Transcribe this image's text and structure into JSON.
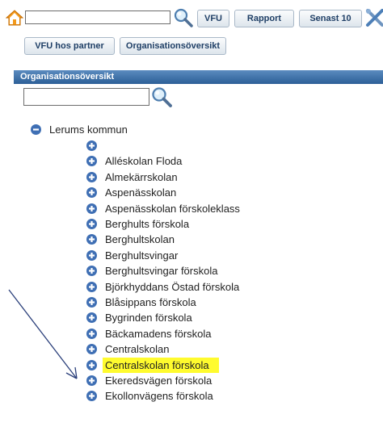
{
  "toolbar": {
    "search_value": "",
    "vfu_label": "VFU",
    "rapport_label": "Rapport",
    "senast_label": "Senast 10",
    "vfu_partner_label": "VFU hos partner",
    "org_overview_label": "Organisationsöversikt"
  },
  "panel": {
    "title": "Organisationsöversikt",
    "search_value": ""
  },
  "tree": {
    "root": {
      "label": "Lerums kommun",
      "icon": "collapse-icon"
    },
    "children": [
      {
        "label": ""
      },
      {
        "label": "Alléskolan Floda"
      },
      {
        "label": "Almekärrskolan"
      },
      {
        "label": "Aspenässkolan"
      },
      {
        "label": "Aspenässkolan förskoleklass"
      },
      {
        "label": "Berghults förskola"
      },
      {
        "label": "Berghultskolan"
      },
      {
        "label": "Berghultsvingar"
      },
      {
        "label": "Berghultsvingar förskola"
      },
      {
        "label": "Björkhyddans Östad förskola"
      },
      {
        "label": "Blåsippans förskola"
      },
      {
        "label": "Bygrinden förskola"
      },
      {
        "label": "Bäckamadens förskola"
      },
      {
        "label": "Centralskolan"
      },
      {
        "label": "Centralskolan förskola",
        "highlighted": true
      },
      {
        "label": "Ekeredsvägen förskola"
      },
      {
        "label": "Ekollonvägens förskola"
      }
    ]
  },
  "colors": {
    "header_gradient_top": "#5b8bbf",
    "header_gradient_bottom": "#2c5f97",
    "tree_icon": "#3f6fb4",
    "highlight": "#fffb2e",
    "annotation_arrow": "#2a3f7a"
  }
}
